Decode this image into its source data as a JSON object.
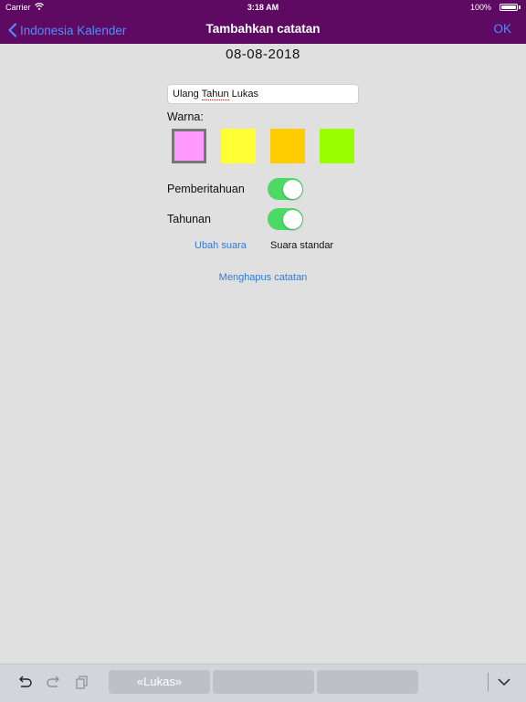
{
  "status_bar": {
    "carrier": "Carrier",
    "time": "3:18 AM",
    "battery": "100%"
  },
  "nav": {
    "back_label": "Indonesia Kalender",
    "title": "Tambahkan catatan",
    "ok_label": "OK"
  },
  "date": "08-08-2018",
  "note_input": {
    "value_before": "Ulang ",
    "value_underlined": "Tahun",
    "value_after": " Lukas"
  },
  "color_label": "Warna:",
  "colors": [
    {
      "hex": "#ff99ff",
      "selected": true
    },
    {
      "hex": "#ffff33",
      "selected": false
    },
    {
      "hex": "#ffcc00",
      "selected": false
    },
    {
      "hex": "#99ff00",
      "selected": false
    }
  ],
  "notification": {
    "label": "Pemberitahuan",
    "on": true
  },
  "yearly": {
    "label": "Tahunan",
    "on": true
  },
  "sound": {
    "change_label": "Ubah suara",
    "current": "Suara standar"
  },
  "delete_label": "Menghapus catatan",
  "keyboard": {
    "suggestions": [
      "«Lukas»",
      "",
      ""
    ]
  },
  "accent_color": "#5e0a62"
}
